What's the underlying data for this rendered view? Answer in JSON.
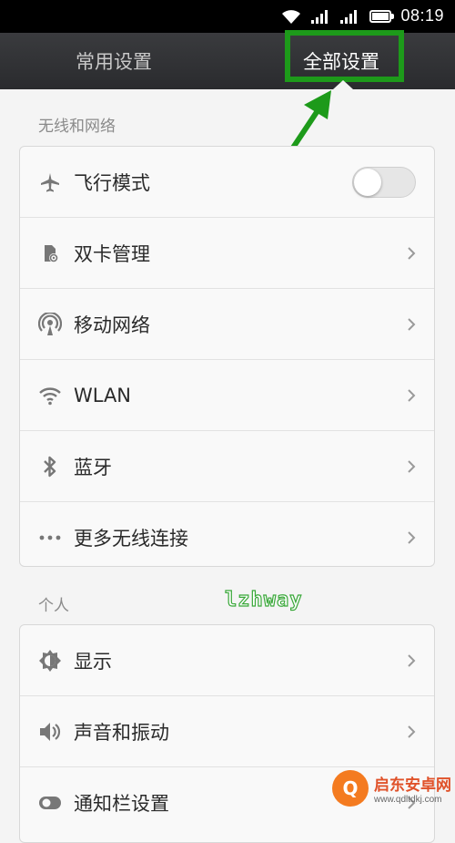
{
  "status_bar": {
    "time": "08:19"
  },
  "tabs": {
    "common": "常用设置",
    "all": "全部设置"
  },
  "sections": [
    {
      "title": "无线和网络",
      "items": [
        {
          "label": "飞行模式",
          "icon": "airplane-icon",
          "control": "toggle",
          "toggle_on": false
        },
        {
          "label": "双卡管理",
          "icon": "sim-card-icon",
          "control": "chevron"
        },
        {
          "label": "移动网络",
          "icon": "mobile-network-icon",
          "control": "chevron"
        },
        {
          "label": "WLAN",
          "icon": "wifi-icon",
          "control": "chevron"
        },
        {
          "label": "蓝牙",
          "icon": "bluetooth-icon",
          "control": "chevron"
        },
        {
          "label": "更多无线连接",
          "icon": "more-dots-icon",
          "control": "chevron"
        }
      ]
    },
    {
      "title": "个人",
      "items": [
        {
          "label": "显示",
          "icon": "brightness-icon",
          "control": "chevron"
        },
        {
          "label": "声音和振动",
          "icon": "speaker-icon",
          "control": "chevron"
        },
        {
          "label": "通知栏设置",
          "icon": "notification-toggle-icon",
          "control": "chevron"
        }
      ]
    }
  ],
  "watermark": "lzhway",
  "site_badge": {
    "name": "启东安卓网",
    "url": "www.qdltdkj.com"
  },
  "colors": {
    "highlight": "#1d9a1a",
    "topbar": "#2f3033",
    "active_tab": "#ffffff",
    "inactive_tab": "#c8c8c8"
  }
}
